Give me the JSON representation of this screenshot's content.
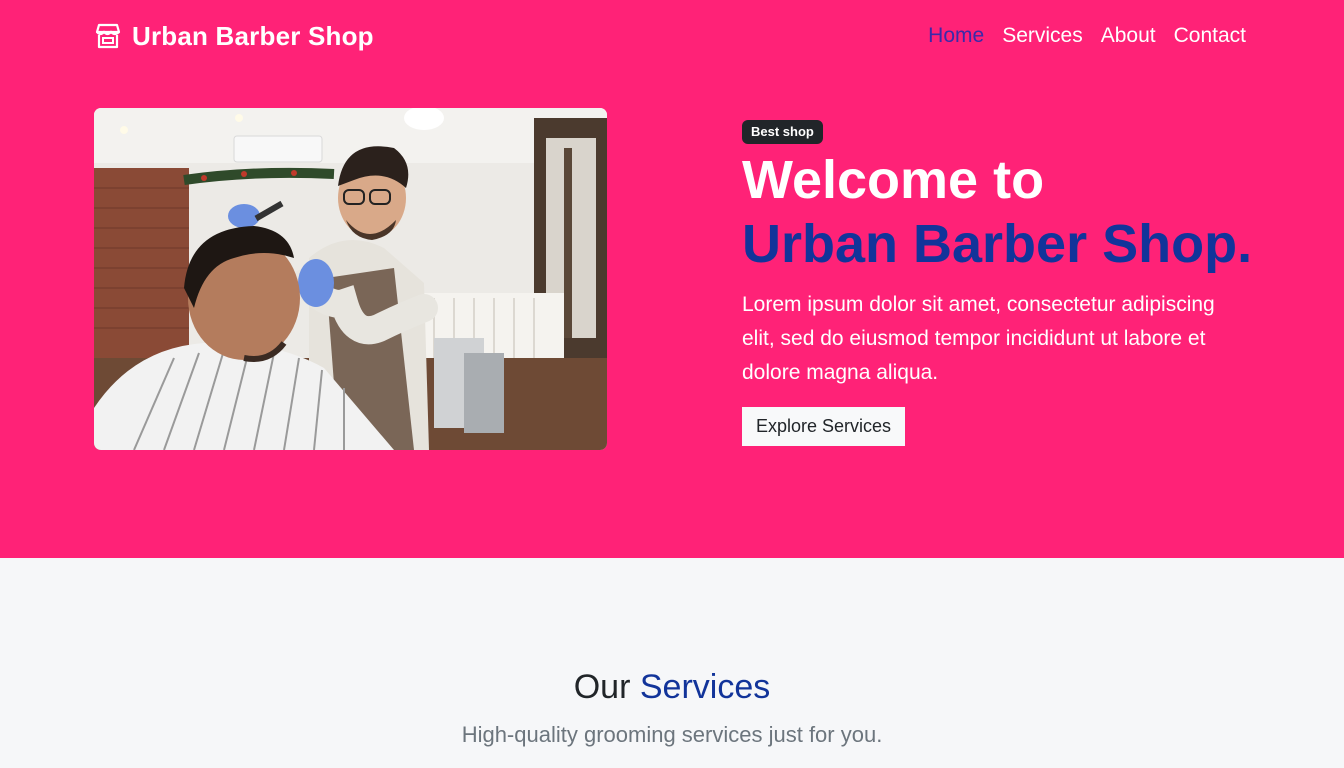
{
  "navbar": {
    "brand_icon": "shop-icon",
    "brand_name": "Urban Barber Shop",
    "links": [
      {
        "label": "Home",
        "active": true
      },
      {
        "label": "Services",
        "active": false
      },
      {
        "label": "About",
        "active": false
      },
      {
        "label": "Contact",
        "active": false
      }
    ]
  },
  "hero": {
    "badge": "Best shop",
    "heading_line1": "Welcome to",
    "heading_line2": "Urban Barber Shop.",
    "lead": "Lorem ipsum dolor sit amet, consectetur adipiscing elit, sed do eiusmod tempor incididunt ut labore et dolore magna aliqua.",
    "cta_label": "Explore Services",
    "image_subject": "barber-cutting-hair-photo"
  },
  "services": {
    "title_part1": "Our",
    "title_part2": "Services",
    "subtitle": "High-quality grooming services just for you."
  },
  "colors": {
    "hero_bg": "#ff2277",
    "accent_blue": "#12349a",
    "active_nav": "#3b2aa8",
    "badge_bg": "#212529",
    "page_bg": "#f6f7f9"
  }
}
